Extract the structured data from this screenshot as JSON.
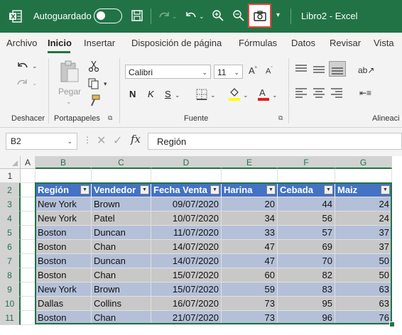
{
  "titlebar": {
    "autosave_label": "Autoguardado",
    "autosave_state": "off",
    "document_title": "Libro2 - Excel",
    "accent": "#217346",
    "highlight_color": "#e04a3a"
  },
  "tabs": [
    {
      "label": "Archivo"
    },
    {
      "label": "Inicio",
      "active": true
    },
    {
      "label": "Insertar"
    },
    {
      "label": "Disposición de página"
    },
    {
      "label": "Fórmulas"
    },
    {
      "label": "Datos"
    },
    {
      "label": "Revisar"
    },
    {
      "label": "Vista"
    }
  ],
  "ribbon": {
    "groups": {
      "undo": "Deshacer",
      "clipboard": "Portapapeles",
      "font": "Fuente",
      "alignment": "Alineaci"
    },
    "paste_label": "Pegar",
    "font_name": "Calibri",
    "font_size": "11",
    "bold": "N",
    "italic": "K",
    "underline": "S"
  },
  "formula_bar": {
    "name_box": "B2",
    "fx": "fx",
    "content": "Región"
  },
  "grid": {
    "column_headers": [
      "A",
      "B",
      "C",
      "D",
      "E",
      "F",
      "G"
    ],
    "row_headers": [
      "1",
      "2",
      "3",
      "4",
      "5",
      "6",
      "7",
      "8",
      "9",
      "10",
      "11"
    ],
    "table_header": [
      "Región",
      "Vendedor",
      "Fecha Venta",
      "Harina",
      "Cebada",
      "Maiz"
    ],
    "rows": [
      [
        "New York",
        "Brown",
        "09/07/2020",
        "20",
        "44",
        "24"
      ],
      [
        "New York",
        "Patel",
        "10/07/2020",
        "34",
        "56",
        "24"
      ],
      [
        "Boston",
        "Duncan",
        "11/07/2020",
        "33",
        "57",
        "37"
      ],
      [
        "Boston",
        "Chan",
        "14/07/2020",
        "47",
        "69",
        "37"
      ],
      [
        "Boston",
        "Duncan",
        "14/07/2020",
        "47",
        "70",
        "50"
      ],
      [
        "Boston",
        "Chan",
        "15/07/2020",
        "60",
        "82",
        "50"
      ],
      [
        "New York",
        "Brown",
        "15/07/2020",
        "59",
        "83",
        "63"
      ],
      [
        "Dallas",
        "Collins",
        "16/07/2020",
        "73",
        "95",
        "63"
      ],
      [
        "Boston",
        "Chan",
        "21/07/2020",
        "73",
        "96",
        "76"
      ]
    ],
    "header_color": "#4472c4",
    "band_colors": [
      "#b4c0d8",
      "#c8c8c8"
    ]
  }
}
